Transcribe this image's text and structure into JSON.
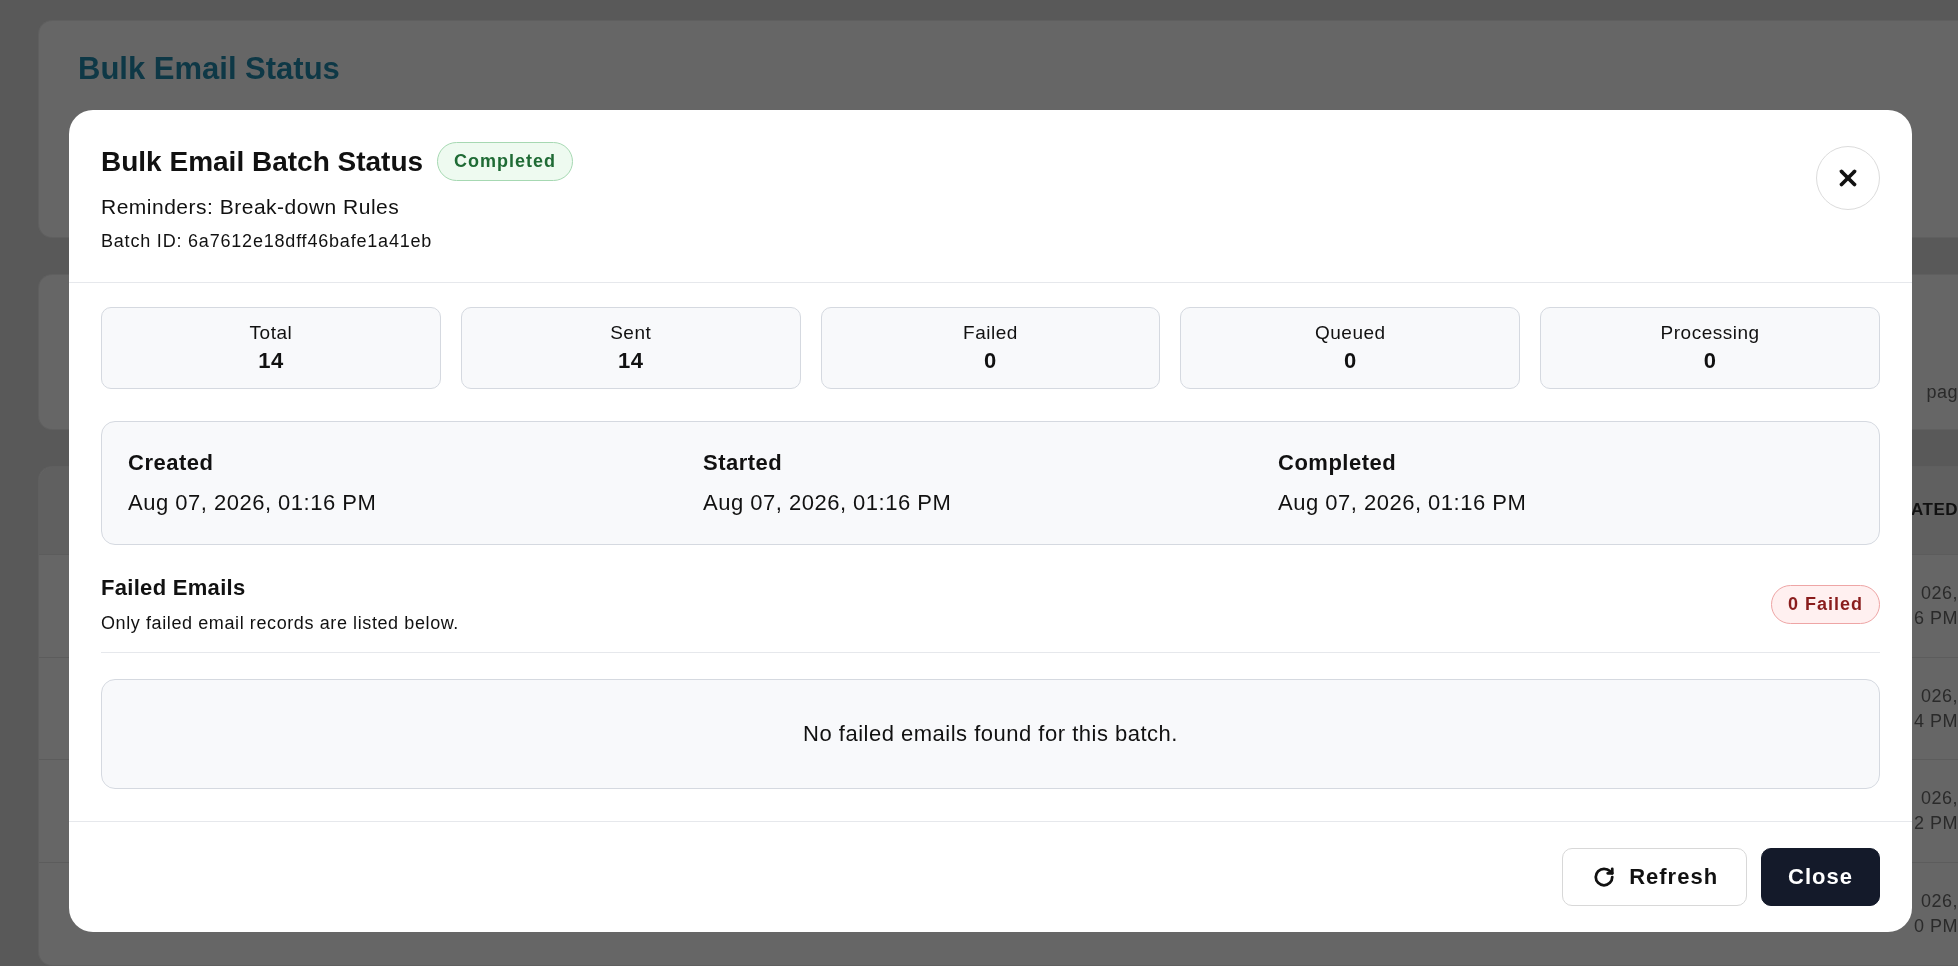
{
  "background": {
    "title": "Bulk Email Status",
    "summary_fragment": "pag",
    "table_header_fragment": "ATED",
    "row_fragments": [
      {
        "date": "026,",
        "time": "6 PM"
      },
      {
        "date": "026,",
        "time": "4 PM"
      },
      {
        "date": "026,",
        "time": "2 PM"
      },
      {
        "date": "026,",
        "time": "0 PM"
      }
    ]
  },
  "modal": {
    "title": "Bulk Email Batch Status",
    "status": {
      "label": "Completed",
      "kind": "success"
    },
    "subtitle": "Reminders: Break-down Rules",
    "batch_id": "Batch ID: 6a7612e18dff46bafe1a41eb",
    "stats": [
      {
        "label": "Total",
        "value": "14"
      },
      {
        "label": "Sent",
        "value": "14"
      },
      {
        "label": "Failed",
        "value": "0"
      },
      {
        "label": "Queued",
        "value": "0"
      },
      {
        "label": "Processing",
        "value": "0"
      }
    ],
    "dates": [
      {
        "label": "Created",
        "value": "Aug 07, 2026, 01:16 PM"
      },
      {
        "label": "Started",
        "value": "Aug 07, 2026, 01:16 PM"
      },
      {
        "label": "Completed",
        "value": "Aug 07, 2026, 01:16 PM"
      }
    ],
    "failed_section": {
      "title": "Failed Emails",
      "description": "Only failed email records are listed below.",
      "badge": "0 Failed",
      "empty_message": "No failed emails found for this batch."
    },
    "buttons": [
      {
        "label": "Refresh",
        "kind": "secondary"
      },
      {
        "label": "Close",
        "kind": "primary"
      }
    ]
  }
}
